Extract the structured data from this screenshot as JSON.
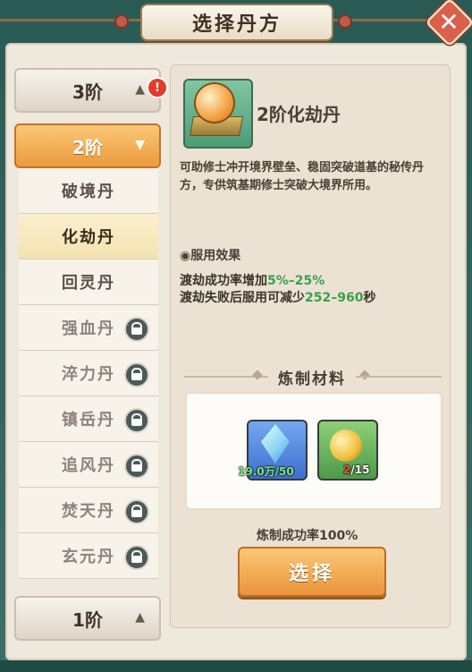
{
  "title": "选择丹方",
  "close_icon": "close-icon",
  "tiers": {
    "tier3": {
      "label": "3阶",
      "alert": "!"
    },
    "tier2": {
      "label": "2阶"
    },
    "tier1": {
      "label": "1阶"
    }
  },
  "pills": [
    {
      "name": "破境丹",
      "locked": false,
      "selected": false
    },
    {
      "name": "化劫丹",
      "locked": false,
      "selected": true
    },
    {
      "name": "回灵丹",
      "locked": false,
      "selected": false
    },
    {
      "name": "强血丹",
      "locked": true,
      "selected": false
    },
    {
      "name": "淬力丹",
      "locked": true,
      "selected": false
    },
    {
      "name": "镇岳丹",
      "locked": true,
      "selected": false
    },
    {
      "name": "追风丹",
      "locked": true,
      "selected": false
    },
    {
      "name": "焚天丹",
      "locked": true,
      "selected": false
    },
    {
      "name": "玄元丹",
      "locked": true,
      "selected": false
    }
  ],
  "detail": {
    "name": "2阶化劫丹",
    "description": "可助修士冲开境界壁垒、稳固突破道基的秘传丹方，专供筑基期修士突破大境界所用。",
    "effect_title": "◉服用效果",
    "effect1_prefix": "渡劫成功率增加",
    "effect1_value": "5%–25%",
    "effect2_prefix": "渡劫失败后服用可减少",
    "effect2_value": "252–960",
    "effect2_suffix": "秒"
  },
  "materials": {
    "title": "炼制材料",
    "items": [
      {
        "icon": "crystal-icon",
        "count": "19.0万/50",
        "count_color": "#7fe87f"
      },
      {
        "icon": "gold-orb-icon",
        "count_have": "2",
        "count_need": "/15",
        "count_color": "#ff4b3a"
      }
    ]
  },
  "success_rate": "炼制成功率100%",
  "choose_label": "选择",
  "colors": {
    "accent_orange": "#ec9a3d",
    "green": "#3aa04c",
    "panel": "#efe8dc"
  }
}
